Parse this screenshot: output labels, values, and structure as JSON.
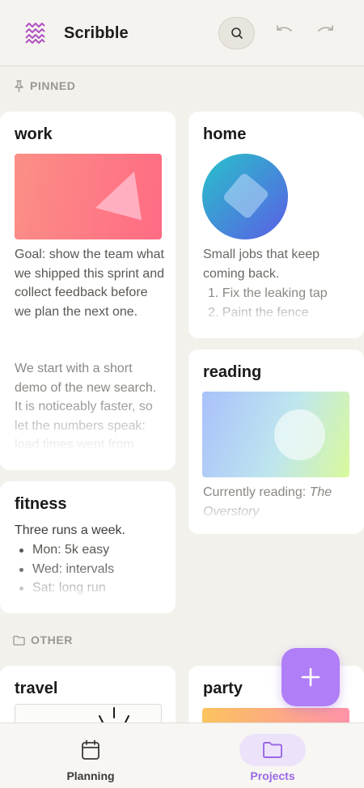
{
  "app": {
    "title": "Scribble"
  },
  "sections": {
    "pinned": "PINNED",
    "other": "OTHER"
  },
  "cards": {
    "work": {
      "title": "work",
      "body1": "Goal: show the team what we shipped this sprint and collect feedback before we plan the next one.",
      "body2": "We start with a short demo of the new search. It is noticeably faster, so let the numbers speak: load times went from"
    },
    "home": {
      "title": "home",
      "body": "Small jobs that keep coming back.",
      "items": [
        "Fix the leaking tap",
        "Paint the fence"
      ]
    },
    "reading": {
      "title": "reading",
      "prefix": "Currently reading: ",
      "book": "The Overstory"
    },
    "fitness": {
      "title": "fitness",
      "body": "Three runs a week.",
      "items": [
        "Mon: 5k easy",
        "Wed: intervals",
        "Sat: long run"
      ]
    },
    "travel": {
      "title": "travel"
    },
    "party": {
      "title": "party"
    }
  },
  "nav": {
    "planning": "Planning",
    "projects": "Projects",
    "active": "projects"
  },
  "colors": {
    "accent": "#b07ef7",
    "accent_soft": "#ece3fb",
    "active_text": "#9a68e6",
    "background": "#f3f1ec"
  }
}
